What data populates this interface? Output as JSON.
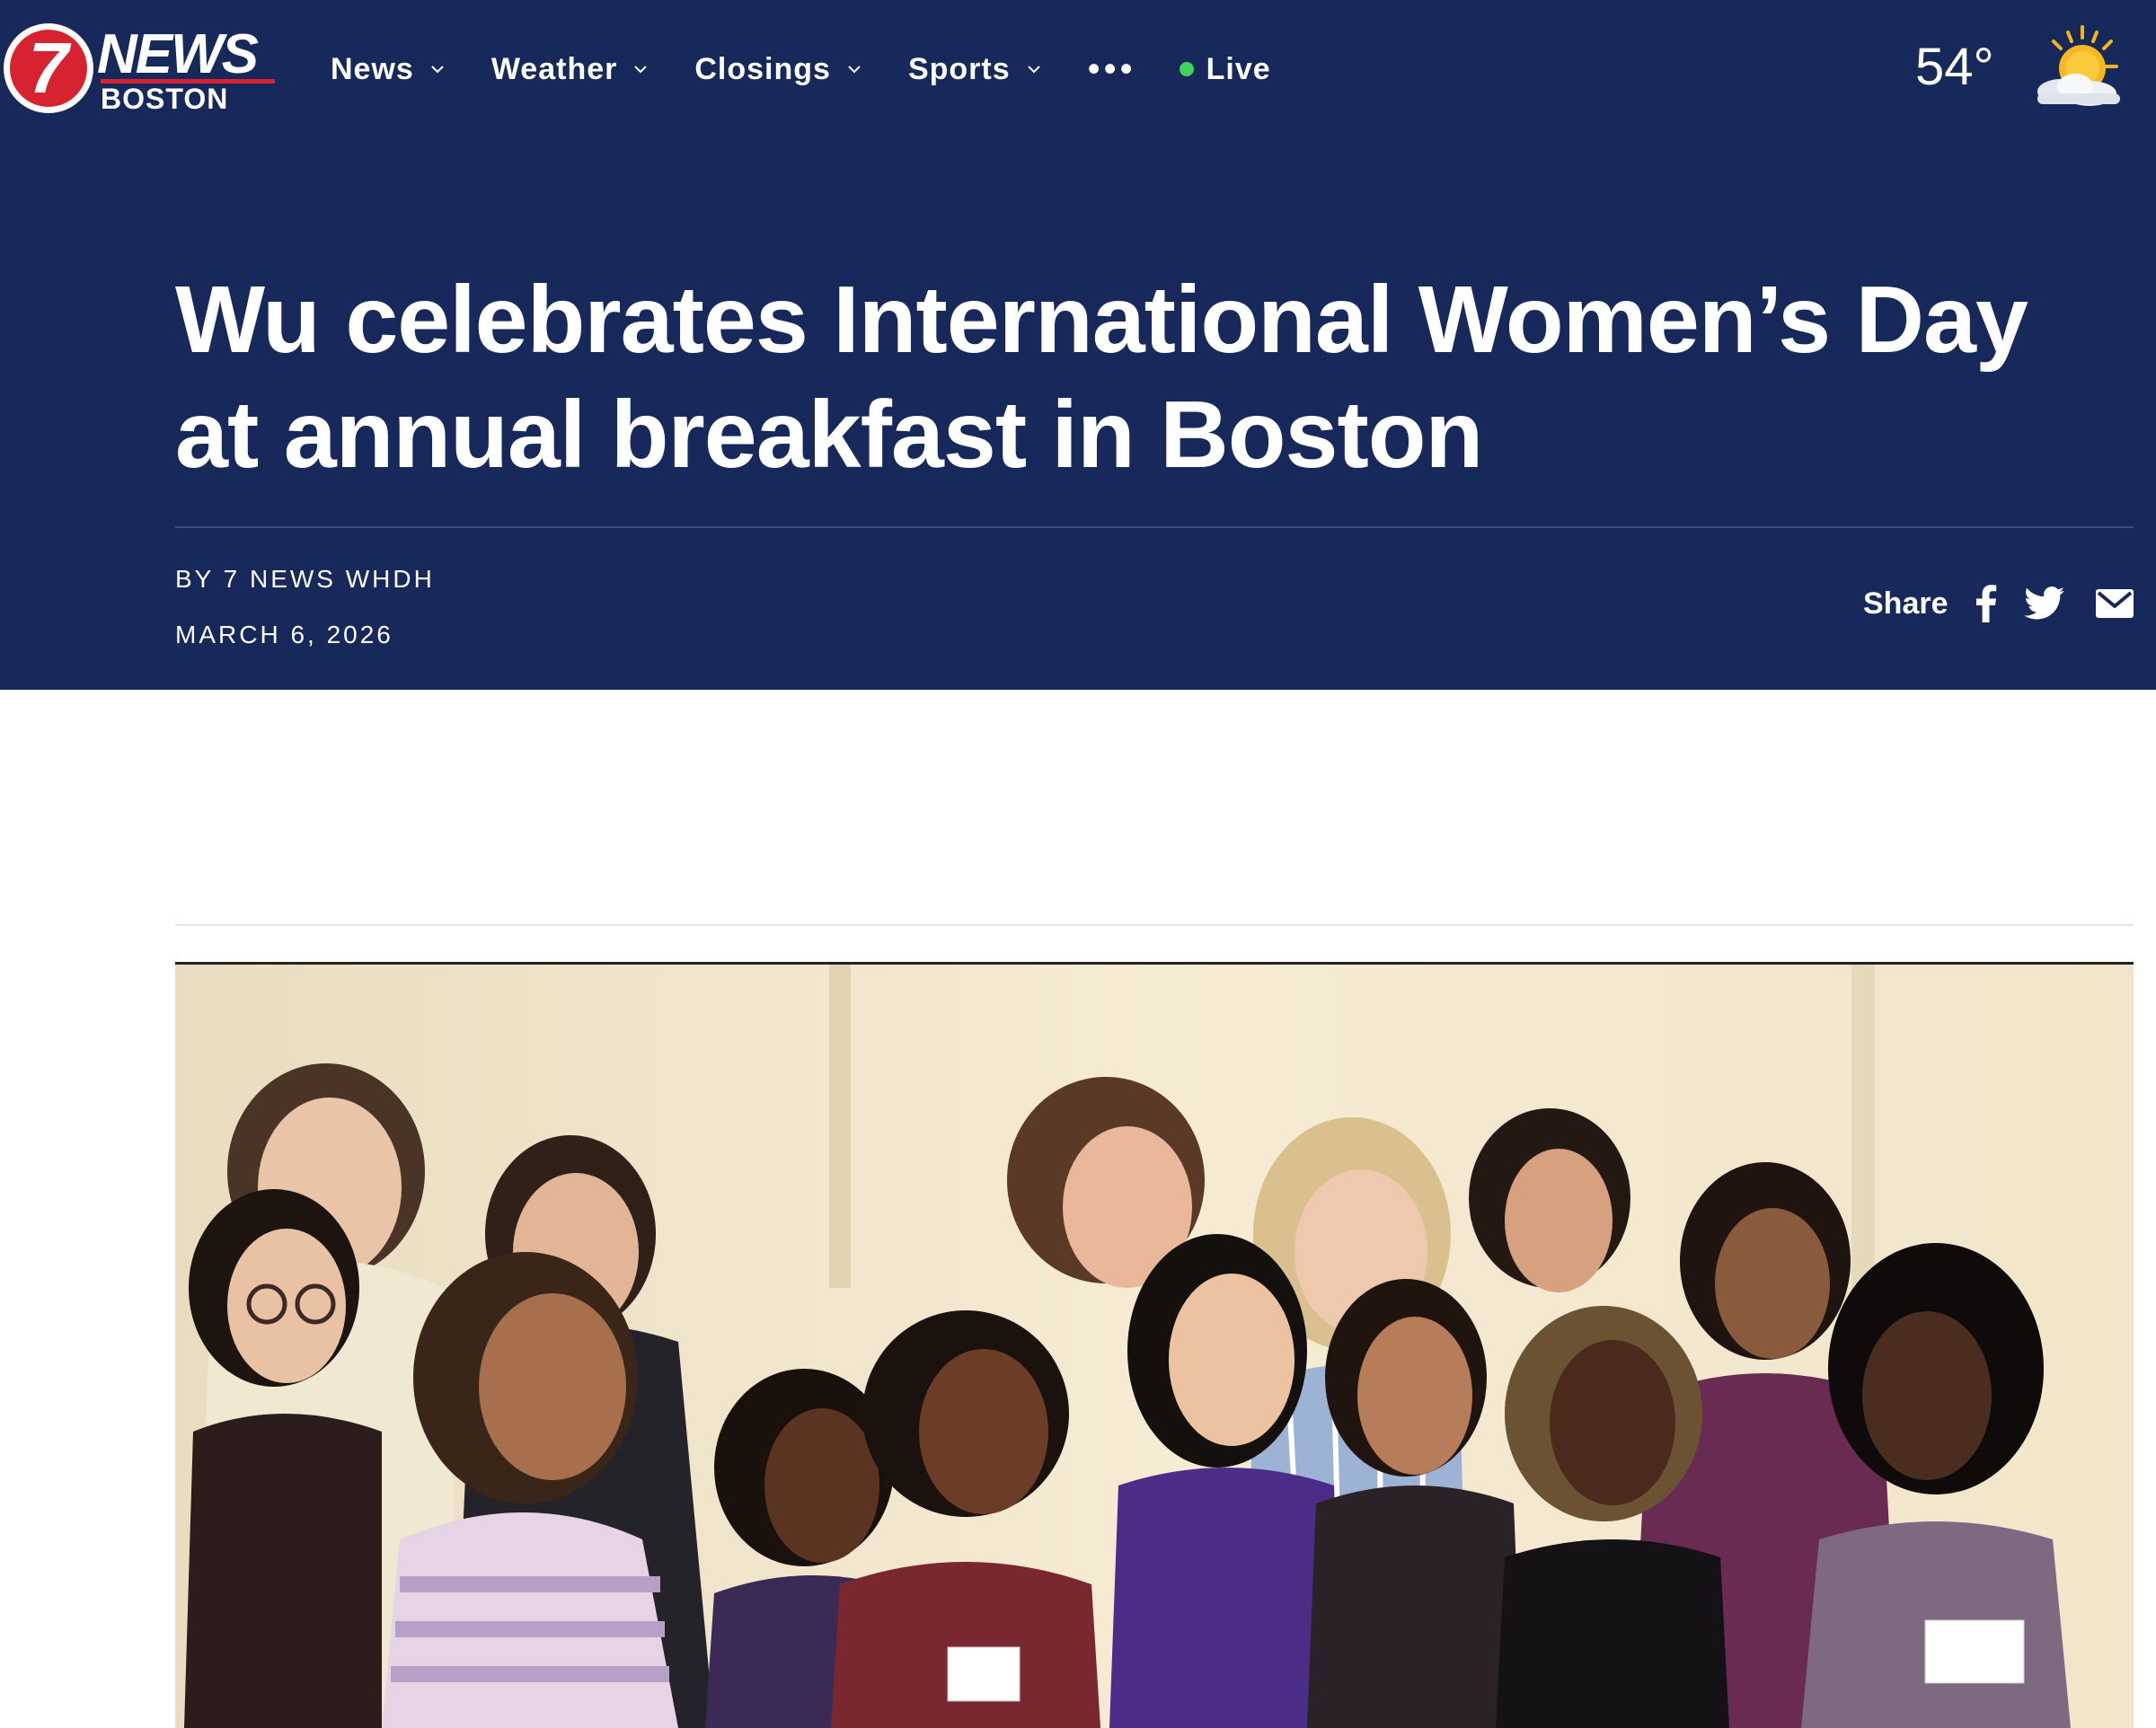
{
  "site": {
    "logo": {
      "number": "7",
      "word": "NEWS",
      "city": "BOSTON",
      "icon": "7news-boston-logo"
    },
    "brand_colors": {
      "navy": "#16295a",
      "red": "#d7232f",
      "live_green": "#3fd35c"
    }
  },
  "nav": {
    "items": [
      {
        "label": "News",
        "icon": "chevron-down-icon"
      },
      {
        "label": "Weather",
        "icon": "chevron-down-icon"
      },
      {
        "label": "Closings",
        "icon": "chevron-down-icon"
      },
      {
        "label": "Sports",
        "icon": "chevron-down-icon"
      }
    ],
    "more_label": "•••",
    "live_label": "Live"
  },
  "weather": {
    "temperature": "54°",
    "icon": "partly-sunny-icon"
  },
  "article": {
    "headline": "Wu celebrates International Women’s Day at annual breakfast in Boston",
    "byline": "BY 7 NEWS WHDH",
    "date": "MARCH 6, 2026",
    "share": {
      "label": "Share",
      "icons": [
        "facebook-icon",
        "twitter-icon",
        "email-icon"
      ]
    },
    "photo": {
      "icon": "group-photo"
    }
  }
}
